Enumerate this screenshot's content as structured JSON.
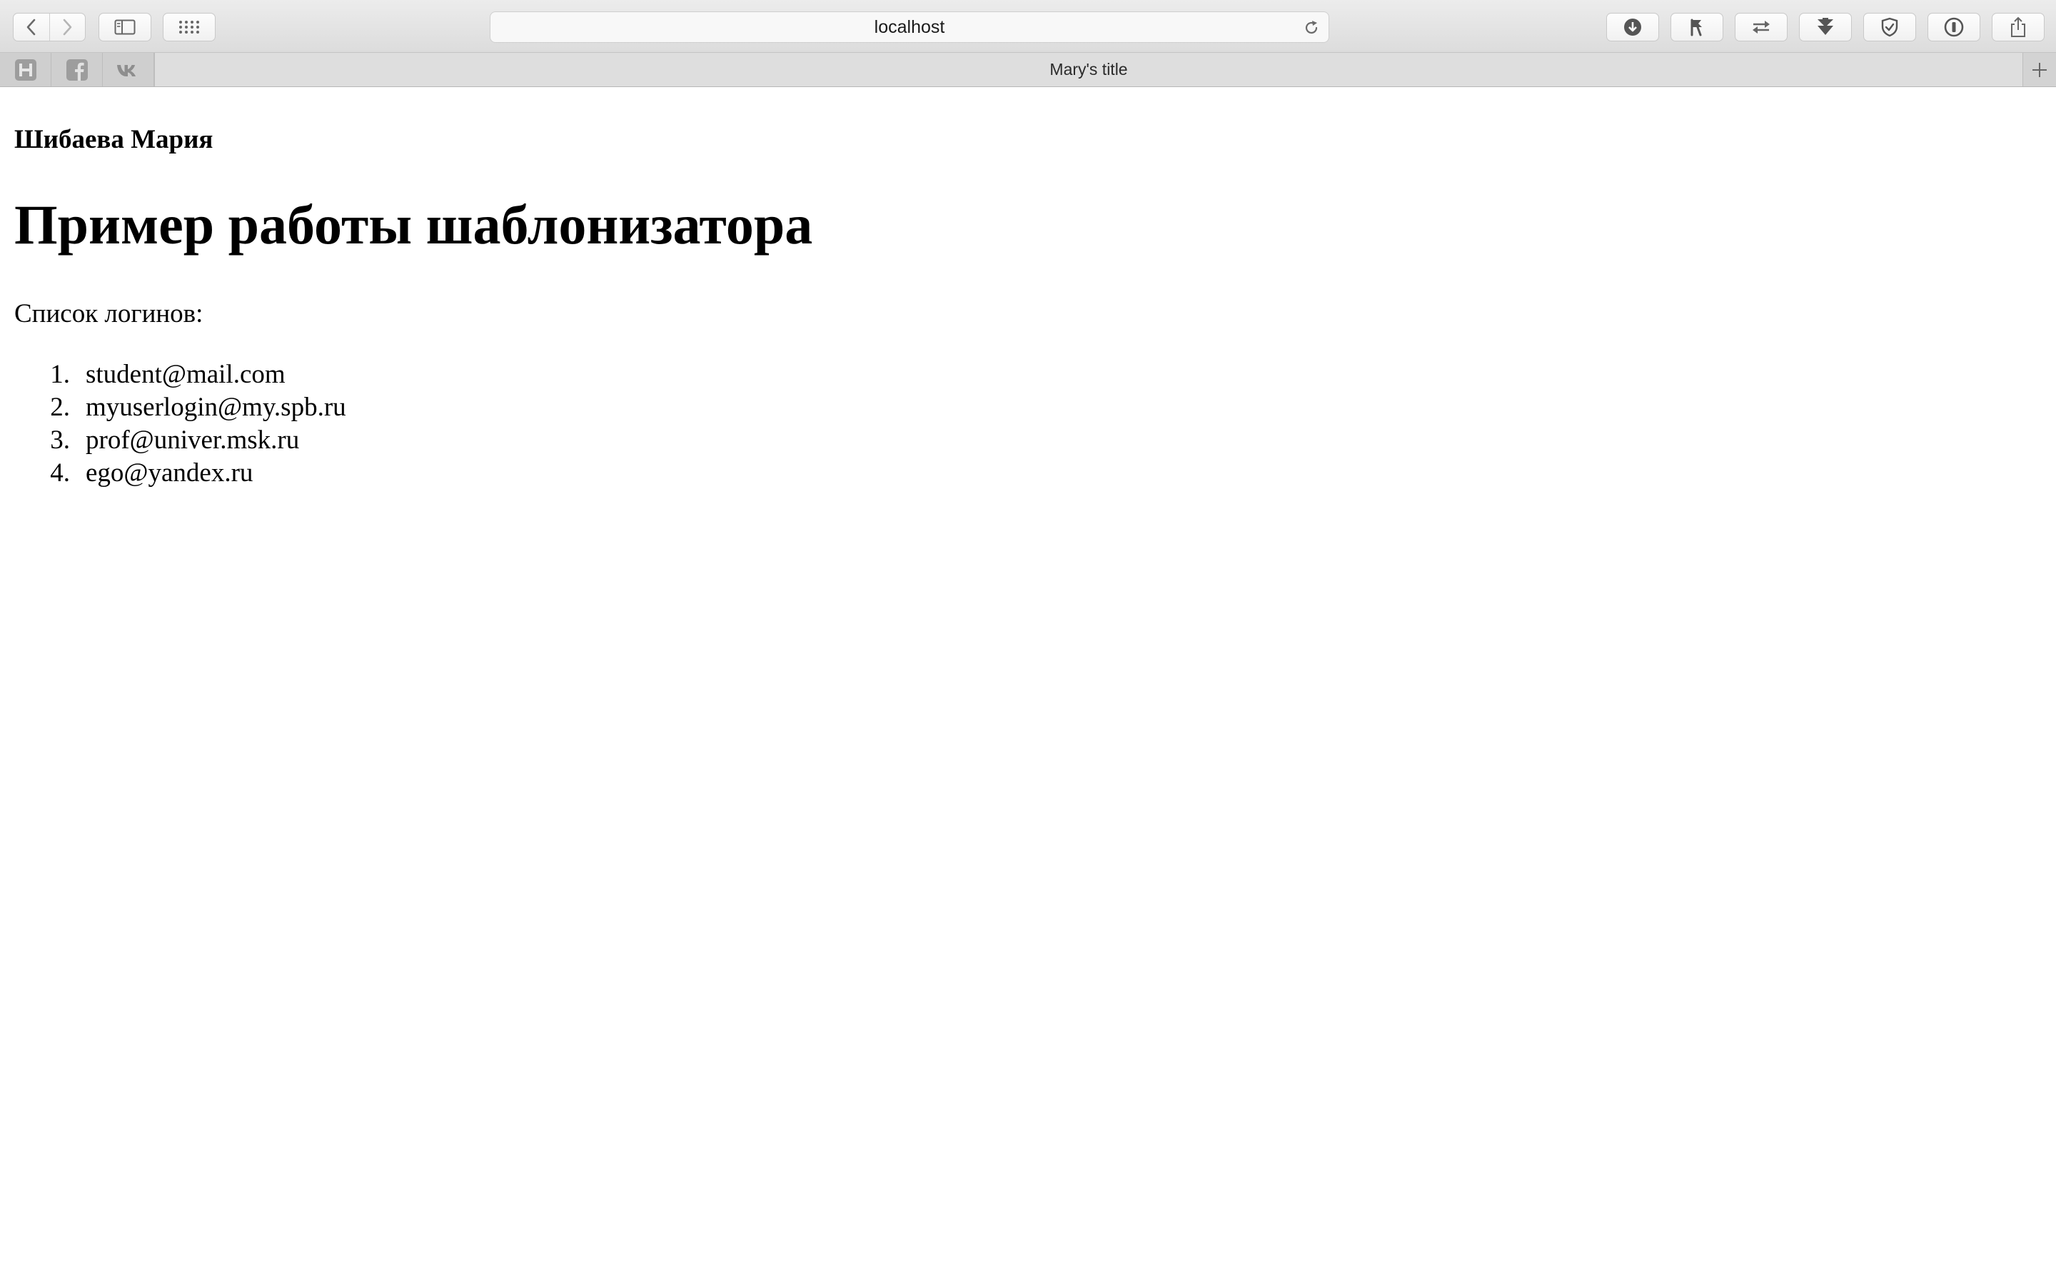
{
  "browser": {
    "address": "localhost",
    "tab_title": "Mary's title",
    "pinned_tabs": [
      {
        "icon": "hacker-news-icon",
        "glyph": "H"
      },
      {
        "icon": "facebook-icon",
        "glyph": "f"
      },
      {
        "icon": "vk-icon",
        "glyph": "vk"
      }
    ]
  },
  "page": {
    "author": "Шибаева Мария",
    "heading": "Пример работы шаблонизатора",
    "list_caption": "Список логинов:",
    "logins": [
      {
        "n": "1.",
        "email": "student@mail.com"
      },
      {
        "n": "2.",
        "email": "myuserlogin@my.spb.ru"
      },
      {
        "n": "3.",
        "email": "prof@univer.msk.ru"
      },
      {
        "n": "4.",
        "email": "ego@yandex.ru"
      }
    ]
  }
}
